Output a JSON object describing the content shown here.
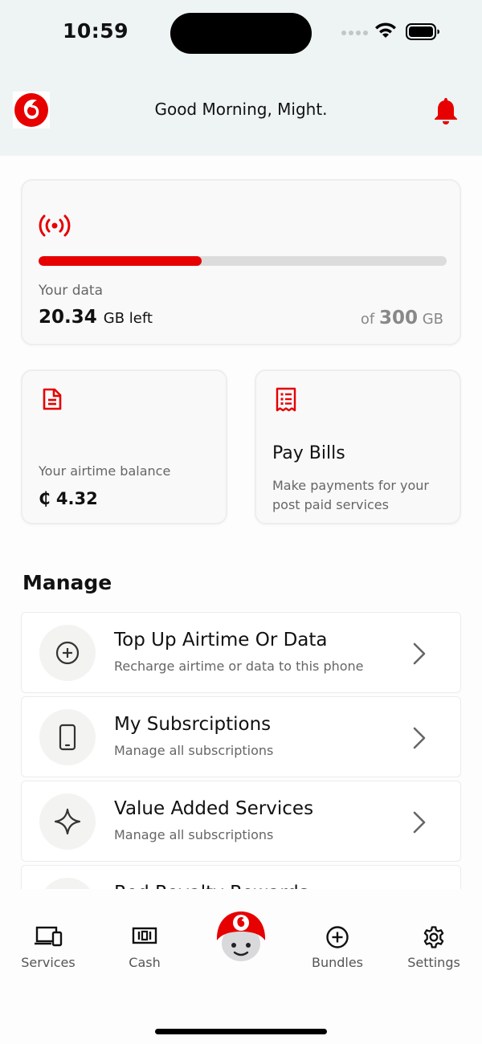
{
  "status_bar": {
    "time": "10:59"
  },
  "header": {
    "greeting": "Good Morning, Might.",
    "logo_icon": "vodafone-logo-icon",
    "notification_icon": "bell-icon"
  },
  "colors": {
    "brand_red": "#e60000",
    "header_bg": "#eef3f4",
    "card_bg": "#f9f9fa"
  },
  "data_card": {
    "icon": "signal-broadcast-icon",
    "label": "Your data",
    "remaining_value": "20.34",
    "remaining_unit": "GB left",
    "total_prefix": "of",
    "total_value": "300",
    "total_unit": "GB",
    "progress_fraction": 0.4
  },
  "airtime_card": {
    "icon": "document-icon",
    "label": "Your airtime balance",
    "value": "₵ 4.32"
  },
  "bills_card": {
    "icon": "receipt-icon",
    "title": "Pay Bills",
    "description": "Make payments for your post paid services"
  },
  "manage": {
    "title": "Manage",
    "items": [
      {
        "icon": "plus-circle-icon",
        "title": "Top Up Airtime Or Data",
        "subtitle": "Recharge airtime or data to this phone"
      },
      {
        "icon": "smartphone-icon",
        "title": "My Subsrciptions",
        "subtitle": "Manage all subscriptions"
      },
      {
        "icon": "sparkle-icon",
        "title": "Value Added Services",
        "subtitle": "Manage all subscriptions"
      },
      {
        "icon": "gift-icon",
        "title": "Red Royalty Rewards",
        "subtitle": ""
      }
    ]
  },
  "bottom_nav": {
    "items": [
      {
        "label": "Services",
        "icon": "devices-icon"
      },
      {
        "label": "Cash",
        "icon": "cash-icon"
      },
      {
        "label": "",
        "icon": "tobi-assistant-icon"
      },
      {
        "label": "Bundles",
        "icon": "plus-circle-icon"
      },
      {
        "label": "Settings",
        "icon": "gear-icon"
      }
    ]
  }
}
